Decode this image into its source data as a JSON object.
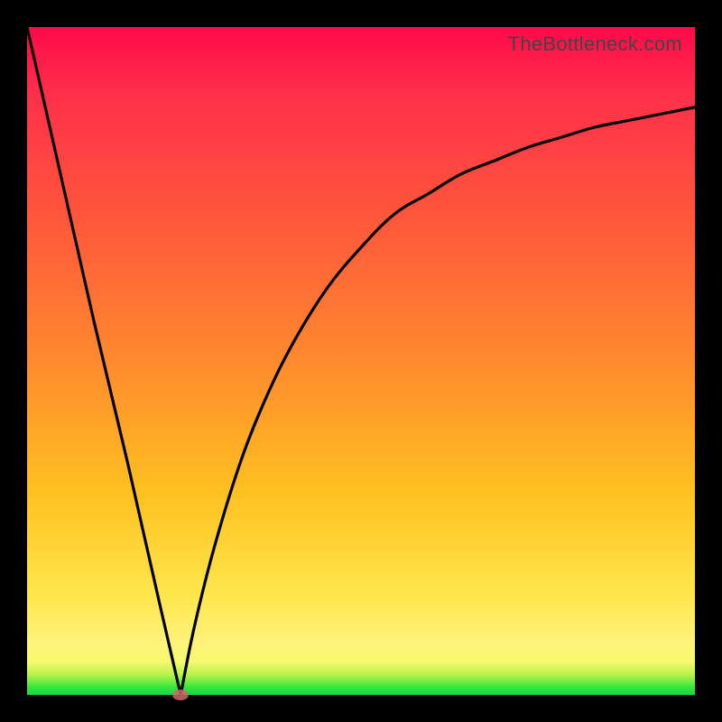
{
  "branding": {
    "text": "TheBottleneck.com"
  },
  "colors": {
    "frame": "#000000",
    "curve_stroke": "#000000",
    "marker": "#d06868",
    "gradient_top": "#ff0a4a",
    "gradient_bottom": "#19d24b"
  },
  "chart_data": {
    "type": "line",
    "title": "",
    "xlabel": "",
    "ylabel": "",
    "xlim": [
      0,
      100
    ],
    "ylim": [
      0,
      100
    ],
    "grid": false,
    "legend": false,
    "annotations": [],
    "series": [
      {
        "name": "left-branch",
        "x": [
          0,
          5,
          10,
          15,
          20,
          23
        ],
        "values": [
          100,
          78,
          56,
          35,
          13,
          0
        ]
      },
      {
        "name": "right-branch",
        "x": [
          23,
          25,
          28,
          32,
          36,
          40,
          45,
          50,
          55,
          60,
          65,
          70,
          75,
          80,
          85,
          90,
          95,
          100
        ],
        "values": [
          0,
          10,
          22,
          35,
          45,
          53,
          61,
          67,
          72,
          75,
          78,
          80,
          82,
          83.5,
          85,
          86,
          87,
          88
        ]
      }
    ],
    "marker": {
      "x": 23,
      "y": 0
    }
  }
}
